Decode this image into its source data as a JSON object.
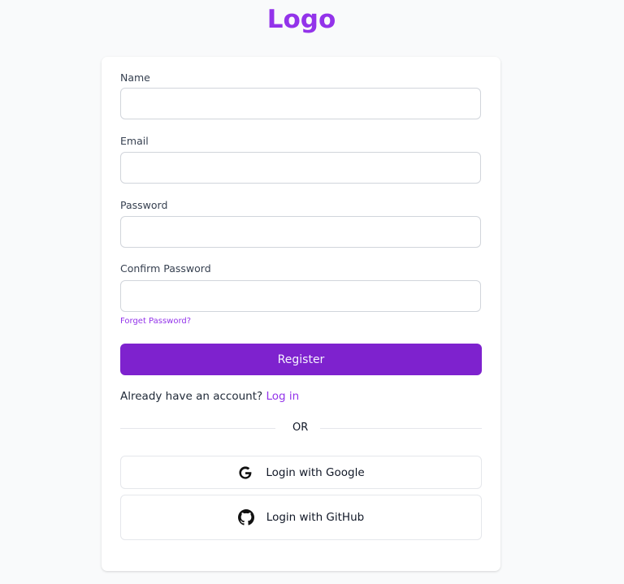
{
  "header": {
    "logo_text": "Logo"
  },
  "form": {
    "fields": [
      {
        "label": "Name",
        "value": "",
        "placeholder": ""
      },
      {
        "label": "Email",
        "value": "",
        "placeholder": ""
      },
      {
        "label": "Password",
        "value": "",
        "placeholder": ""
      },
      {
        "label": "Confirm Password",
        "value": "",
        "placeholder": ""
      }
    ],
    "forget_password": "Forget Password?",
    "register_label": "Register",
    "account_prompt": "Already have an account?",
    "login_link": "Log in",
    "divider_text": "OR"
  },
  "social": {
    "google_label": "Login with Google",
    "github_label": "Login with GitHub",
    "google_icon": "google-icon",
    "github_icon": "github-icon"
  },
  "colors": {
    "accent": "#9333ea",
    "button": "#7e22ce",
    "background": "#f9fafb"
  }
}
